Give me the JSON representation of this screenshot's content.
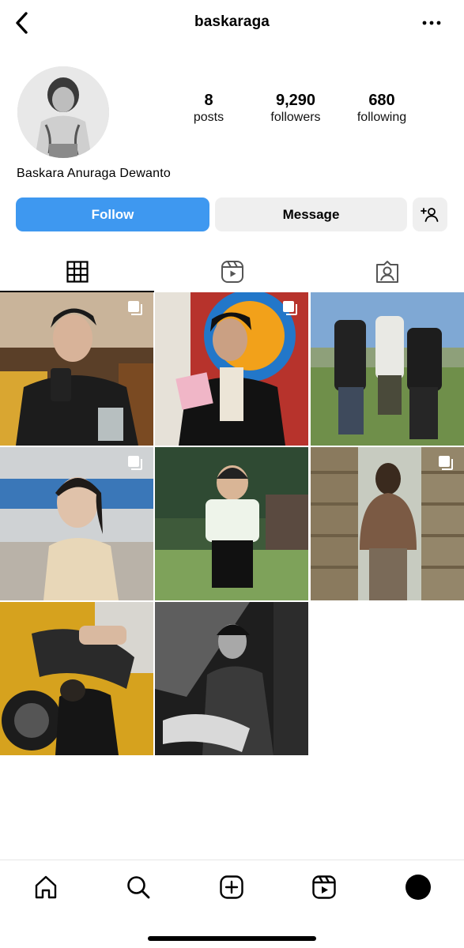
{
  "header": {
    "username": "baskaraga",
    "back_icon": "chevron-left-icon",
    "more_icon": "more-horizontal-icon"
  },
  "profile": {
    "full_name": "Baskara Anuraga Dewanto",
    "stats": [
      {
        "value": "8",
        "label": "posts"
      },
      {
        "value": "9,290",
        "label": "followers"
      },
      {
        "value": "680",
        "label": "following"
      }
    ]
  },
  "actions": {
    "follow_label": "Follow",
    "message_label": "Message",
    "suggest_icon": "add-person-icon"
  },
  "colors": {
    "follow_bg": "#3e98f0",
    "secondary_bg": "#efefef"
  },
  "tabs": [
    {
      "icon": "grid-icon",
      "active": true
    },
    {
      "icon": "reels-icon",
      "active": false
    },
    {
      "icon": "tagged-icon",
      "active": false
    }
  ],
  "posts": [
    {
      "subject": "man in black blazer holding phone in diner",
      "multi": true
    },
    {
      "subject": "man holding pink record at Amoeba Music",
      "multi": true
    },
    {
      "subject": "three men in a green field",
      "multi": false
    },
    {
      "subject": "woman with braid in subway",
      "multi": true
    },
    {
      "subject": "young boy in white shirt outdoors",
      "multi": false
    },
    {
      "subject": "shirtless tattooed man in archive shelves",
      "multi": true
    },
    {
      "subject": "man repairing motorcycle",
      "multi": false
    },
    {
      "subject": "black and white portrait of man seated",
      "multi": false
    }
  ],
  "bottom_nav": [
    {
      "icon": "home-icon"
    },
    {
      "icon": "search-icon"
    },
    {
      "icon": "create-icon"
    },
    {
      "icon": "reels-icon"
    },
    {
      "icon": "profile-avatar"
    }
  ]
}
